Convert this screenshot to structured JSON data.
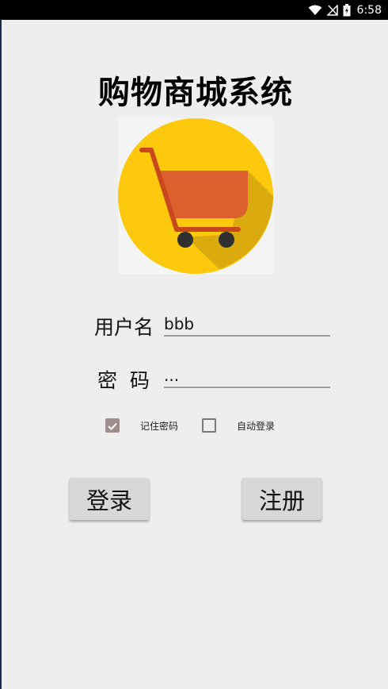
{
  "status_bar": {
    "time": "6:58",
    "icons": [
      "wifi-icon",
      "signal-icon",
      "battery-charging-icon"
    ]
  },
  "app": {
    "title": "购物商城系统",
    "logo_icon": "shopping-cart-icon"
  },
  "form": {
    "username_label": "用户名",
    "username_value": "bbb",
    "password_label": "密  码",
    "password_value": "...",
    "remember_label": "记住密码",
    "remember_checked": true,
    "autologin_label": "自动登录",
    "autologin_checked": false
  },
  "buttons": {
    "login": "登录",
    "register": "注册"
  },
  "colors": {
    "background": "#eeeeee",
    "logo_circle": "#fdc90d",
    "cart_basket": "#dc602d",
    "cart_frame": "#c9471d",
    "wheels": "#2f2f2f",
    "checkbox_checked": "#9e8f8b"
  }
}
